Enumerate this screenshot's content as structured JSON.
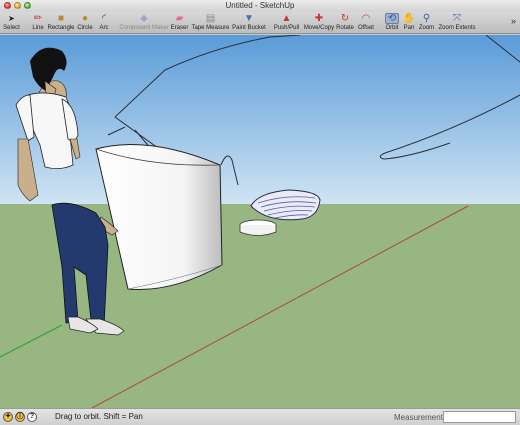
{
  "window": {
    "title": "Untitled - SketchUp"
  },
  "toolbar": {
    "tools": [
      {
        "label": "Select",
        "icon": "arrow-icon",
        "glyph": "➤",
        "color": "#222222"
      },
      {
        "label": "Line",
        "icon": "pencil-icon",
        "glyph": "✏",
        "color": "#c0392b"
      },
      {
        "label": "Rectangle",
        "icon": "rectangle-icon",
        "glyph": "■",
        "color": "#b58a3b"
      },
      {
        "label": "Circle",
        "icon": "circle-icon",
        "glyph": "●",
        "color": "#b58a3b"
      },
      {
        "label": "Arc",
        "icon": "arc-icon",
        "glyph": "◜",
        "color": "#333333"
      },
      {
        "label": "Component Maker",
        "icon": "component-icon",
        "glyph": "◆",
        "color": "#5b7fb8"
      },
      {
        "label": "Eraser",
        "icon": "eraser-icon",
        "glyph": "▰",
        "color": "#e06a9a"
      },
      {
        "label": "Tape Measure",
        "icon": "tape-measure-icon",
        "glyph": "▤",
        "color": "#8a8a8a"
      },
      {
        "label": "Paint Bucket",
        "icon": "paint-bucket-icon",
        "glyph": "▼",
        "color": "#3b6fc4"
      },
      {
        "label": "Push/Pull",
        "icon": "push-pull-icon",
        "glyph": "▲",
        "color": "#c0392b"
      },
      {
        "label": "Move/Copy",
        "icon": "move-icon",
        "glyph": "✚",
        "color": "#c0392b"
      },
      {
        "label": "Rotate",
        "icon": "rotate-icon",
        "glyph": "↻",
        "color": "#c0392b"
      },
      {
        "label": "Offset",
        "icon": "offset-icon",
        "glyph": "◠",
        "color": "#c0392b"
      },
      {
        "label": "Orbit",
        "icon": "orbit-icon",
        "glyph": "⟲",
        "color": "#2e5da8"
      },
      {
        "label": "Pan",
        "icon": "pan-hand-icon",
        "glyph": "✋",
        "color": "#444444"
      },
      {
        "label": "Zoom",
        "icon": "zoom-icon",
        "glyph": "⚲",
        "color": "#2e5da8"
      },
      {
        "label": "Zoom Extents",
        "icon": "zoom-extents-icon",
        "glyph": "⤧",
        "color": "#2e5da8"
      }
    ],
    "active_tool": "Orbit",
    "disabled_tool": "Component Maker",
    "overflow_glyph": "»"
  },
  "viewport": {
    "sky_color_top": "#5a9bd8",
    "sky_color_bottom": "#cfe4f3",
    "ground_color": "#97b682",
    "red_axis_color": "#b04a3a",
    "green_axis_color": "#2fa32f"
  },
  "statusbar": {
    "icons": [
      "geo-location-icon",
      "credits-icon",
      "help-icon"
    ],
    "icon_glyphs": [
      "✦",
      "ⓘ",
      "?"
    ],
    "message": "Drag to orbit.  Shift = Pan",
    "measurements_label": "Measurements",
    "measurements_value": ""
  }
}
